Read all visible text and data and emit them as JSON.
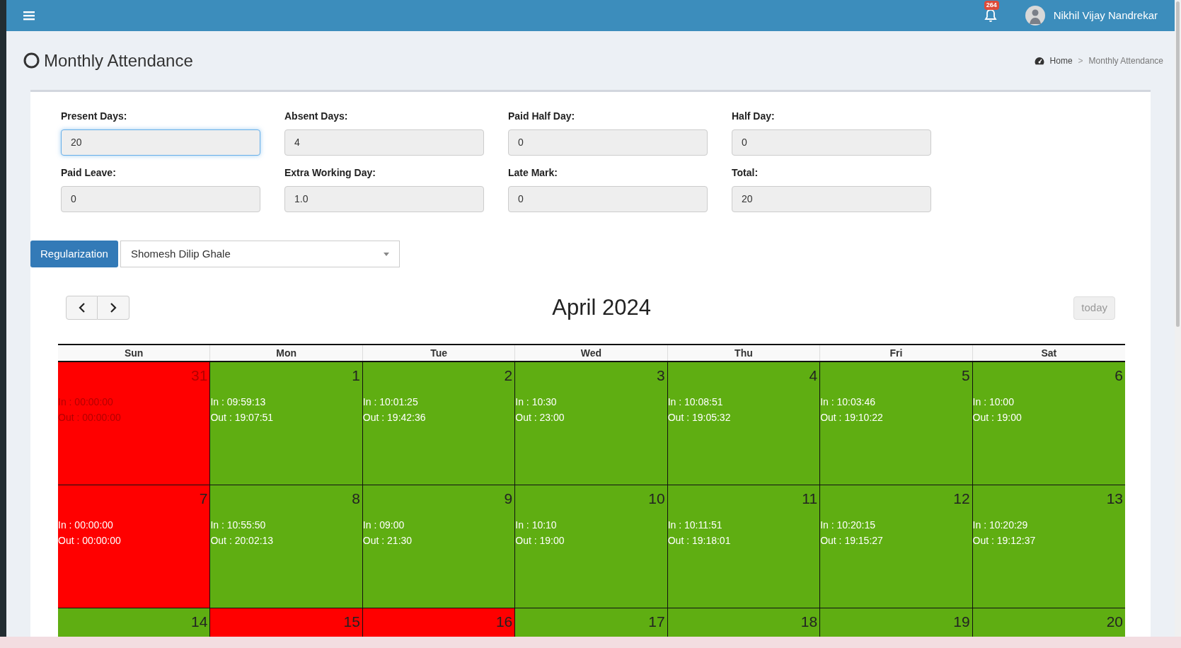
{
  "topbar": {
    "notifications": "264",
    "user": "Nikhil Vijay Nandrekar"
  },
  "page": {
    "title": "Monthly Attendance",
    "breadcrumb_separator": ">",
    "breadcrumb": [
      {
        "label": "Home",
        "current": false
      },
      {
        "label": "Monthly Attendance",
        "current": true
      }
    ]
  },
  "stats": [
    {
      "label": "Present Days:",
      "value": "20",
      "focused": true
    },
    {
      "label": "Absent Days:",
      "value": "4",
      "focused": false
    },
    {
      "label": "Paid Half Day:",
      "value": "0",
      "focused": false
    },
    {
      "label": "Half Day:",
      "value": "0",
      "focused": false
    },
    {
      "label": "Paid Leave:",
      "value": "0",
      "focused": false
    },
    {
      "label": "Extra Working Day:",
      "value": "1.0",
      "focused": false
    },
    {
      "label": "Late Mark:",
      "value": "0",
      "focused": false
    },
    {
      "label": "Total:",
      "value": "20",
      "focused": false
    }
  ],
  "regularization_button": "Regularization",
  "employee_select": {
    "value": "Shomesh Dilip Ghale"
  },
  "calendar": {
    "title": "April 2024",
    "today_button": "today",
    "weekdays": [
      "Sun",
      "Mon",
      "Tue",
      "Wed",
      "Thu",
      "Fri",
      "Sat"
    ],
    "weeks": [
      [
        {
          "day": "31",
          "color": "#ff0000",
          "dimmed": true,
          "in": "In : 00:00:00",
          "out": "Out : 00:00:00"
        },
        {
          "day": "1",
          "color": "#5fae12",
          "dimmed": false,
          "in": "In : 09:59:13",
          "out": "Out : 19:07:51"
        },
        {
          "day": "2",
          "color": "#5fae12",
          "dimmed": false,
          "in": "In : 10:01:25",
          "out": "Out : 19:42:36"
        },
        {
          "day": "3",
          "color": "#5fae12",
          "dimmed": false,
          "in": "In : 10:30",
          "out": "Out : 23:00"
        },
        {
          "day": "4",
          "color": "#5fae12",
          "dimmed": false,
          "in": "In : 10:08:51",
          "out": "Out : 19:05:32"
        },
        {
          "day": "5",
          "color": "#5fae12",
          "dimmed": false,
          "in": "In : 10:03:46",
          "out": "Out : 19:10:22"
        },
        {
          "day": "6",
          "color": "#5fae12",
          "dimmed": false,
          "in": "In : 10:00",
          "out": "Out : 19:00"
        }
      ],
      [
        {
          "day": "7",
          "color": "#ff0000",
          "dimmed": false,
          "in": "In : 00:00:00",
          "out": "Out : 00:00:00"
        },
        {
          "day": "8",
          "color": "#5fae12",
          "dimmed": false,
          "in": "In : 10:55:50",
          "out": "Out : 20:02:13"
        },
        {
          "day": "9",
          "color": "#5fae12",
          "dimmed": false,
          "in": "In : 09:00",
          "out": "Out : 21:30"
        },
        {
          "day": "10",
          "color": "#5fae12",
          "dimmed": false,
          "in": "In : 10:10",
          "out": "Out : 19:00"
        },
        {
          "day": "11",
          "color": "#5fae12",
          "dimmed": false,
          "in": "In : 10:11:51",
          "out": "Out : 19:18:01"
        },
        {
          "day": "12",
          "color": "#5fae12",
          "dimmed": false,
          "in": "In : 10:20:15",
          "out": "Out : 19:15:27"
        },
        {
          "day": "13",
          "color": "#5fae12",
          "dimmed": false,
          "in": "In : 10:20:29",
          "out": "Out : 19:12:37"
        }
      ],
      [
        {
          "day": "14",
          "color": "#5fae12",
          "dimmed": false
        },
        {
          "day": "15",
          "color": "#ff0000",
          "dimmed": false
        },
        {
          "day": "16",
          "color": "#ff0000",
          "dimmed": false
        },
        {
          "day": "17",
          "color": "#5fae12",
          "dimmed": false
        },
        {
          "day": "18",
          "color": "#5fae12",
          "dimmed": false
        },
        {
          "day": "19",
          "color": "#5fae12",
          "dimmed": false
        },
        {
          "day": "20",
          "color": "#5fae12",
          "dimmed": false
        }
      ]
    ]
  }
}
